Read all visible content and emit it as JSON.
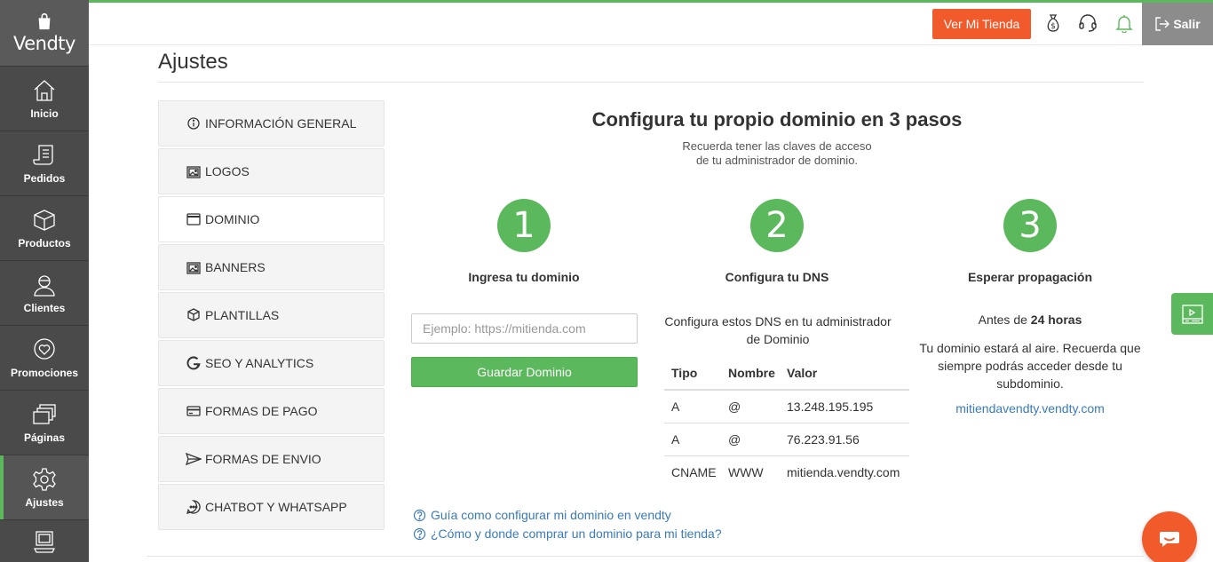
{
  "brand": {
    "name": "Vendty",
    "accent": "#5cb85c",
    "orange": "#f15a2b",
    "sidebar_bg": "#4a4a4a"
  },
  "sidebar": {
    "items": [
      {
        "label": "Inicio",
        "icon": "home-icon"
      },
      {
        "label": "Pedidos",
        "icon": "receipt-icon"
      },
      {
        "label": "Productos",
        "icon": "box-icon"
      },
      {
        "label": "Clientes",
        "icon": "user-icon"
      },
      {
        "label": "Promociones",
        "icon": "heart-chat-icon"
      },
      {
        "label": "Páginas",
        "icon": "pages-icon"
      },
      {
        "label": "Ajustes",
        "icon": "gear-icon",
        "active": true
      },
      {
        "label": "",
        "icon": "computer-icon"
      }
    ]
  },
  "header": {
    "store_button": "Ver Mi Tienda",
    "exit_label": "Salir",
    "icons": [
      "money-bag-icon",
      "headset-icon",
      "bell-icon",
      "logout-icon"
    ]
  },
  "page": {
    "title": "Ajustes"
  },
  "settings_menu": {
    "items": [
      {
        "label": "INFORMACIÓN GENERAL",
        "icon": "info-icon"
      },
      {
        "label": "LOGOS",
        "icon": "image-icon"
      },
      {
        "label": "DOMINIO",
        "icon": "window-icon",
        "active": true
      },
      {
        "label": "BANNERS",
        "icon": "image-icon"
      },
      {
        "label": "PLANTILLAS",
        "icon": "cube-icon"
      },
      {
        "label": "SEO Y ANALYTICS",
        "icon": "google-icon"
      },
      {
        "label": "FORMAS DE PAGO",
        "icon": "card-icon"
      },
      {
        "label": "FORMAS DE ENVIO",
        "icon": "send-icon"
      },
      {
        "label": "CHATBOT Y WHATSAPP",
        "icon": "chat-icon"
      }
    ]
  },
  "domain": {
    "title": "Configura tu propio dominio en 3 pasos",
    "subtitle_line1": "Recuerda tener las claves de acceso",
    "subtitle_line2": "de tu administrador de dominio.",
    "steps": [
      {
        "number": "1",
        "title": "Ingresa tu dominio"
      },
      {
        "number": "2",
        "title": "Configura tu DNS"
      },
      {
        "number": "3",
        "title": "Esperar propagación"
      }
    ],
    "input_placeholder": "Ejemplo: https://mitienda.com",
    "input_value": "",
    "save_button": "Guardar Dominio",
    "dns_intro_line1": "Configura estos DNS en tu administrador",
    "dns_intro_line2": "de Dominio",
    "dns_table": {
      "headers": [
        "Tipo",
        "Nombre",
        "Valor"
      ],
      "rows": [
        [
          "A",
          "@",
          "13.248.195.195"
        ],
        [
          "A",
          "@",
          "76.223.91.56"
        ],
        [
          "CNAME",
          "WWW",
          "mitienda.vendty.com"
        ]
      ]
    },
    "propagation_before": "Antes de ",
    "propagation_time": "24 horas",
    "propagation_line1": "Tu dominio estará al aire. Recuerda que",
    "propagation_line2": "siempre podrás acceder desde tu",
    "propagation_line3": "subdominio.",
    "subdomain_link": "mitiendavendty.vendty.com",
    "help_links": [
      "Guía como configurar mi dominio en vendty",
      "¿Cómo y donde comprar un dominio para mi tienda?"
    ]
  }
}
